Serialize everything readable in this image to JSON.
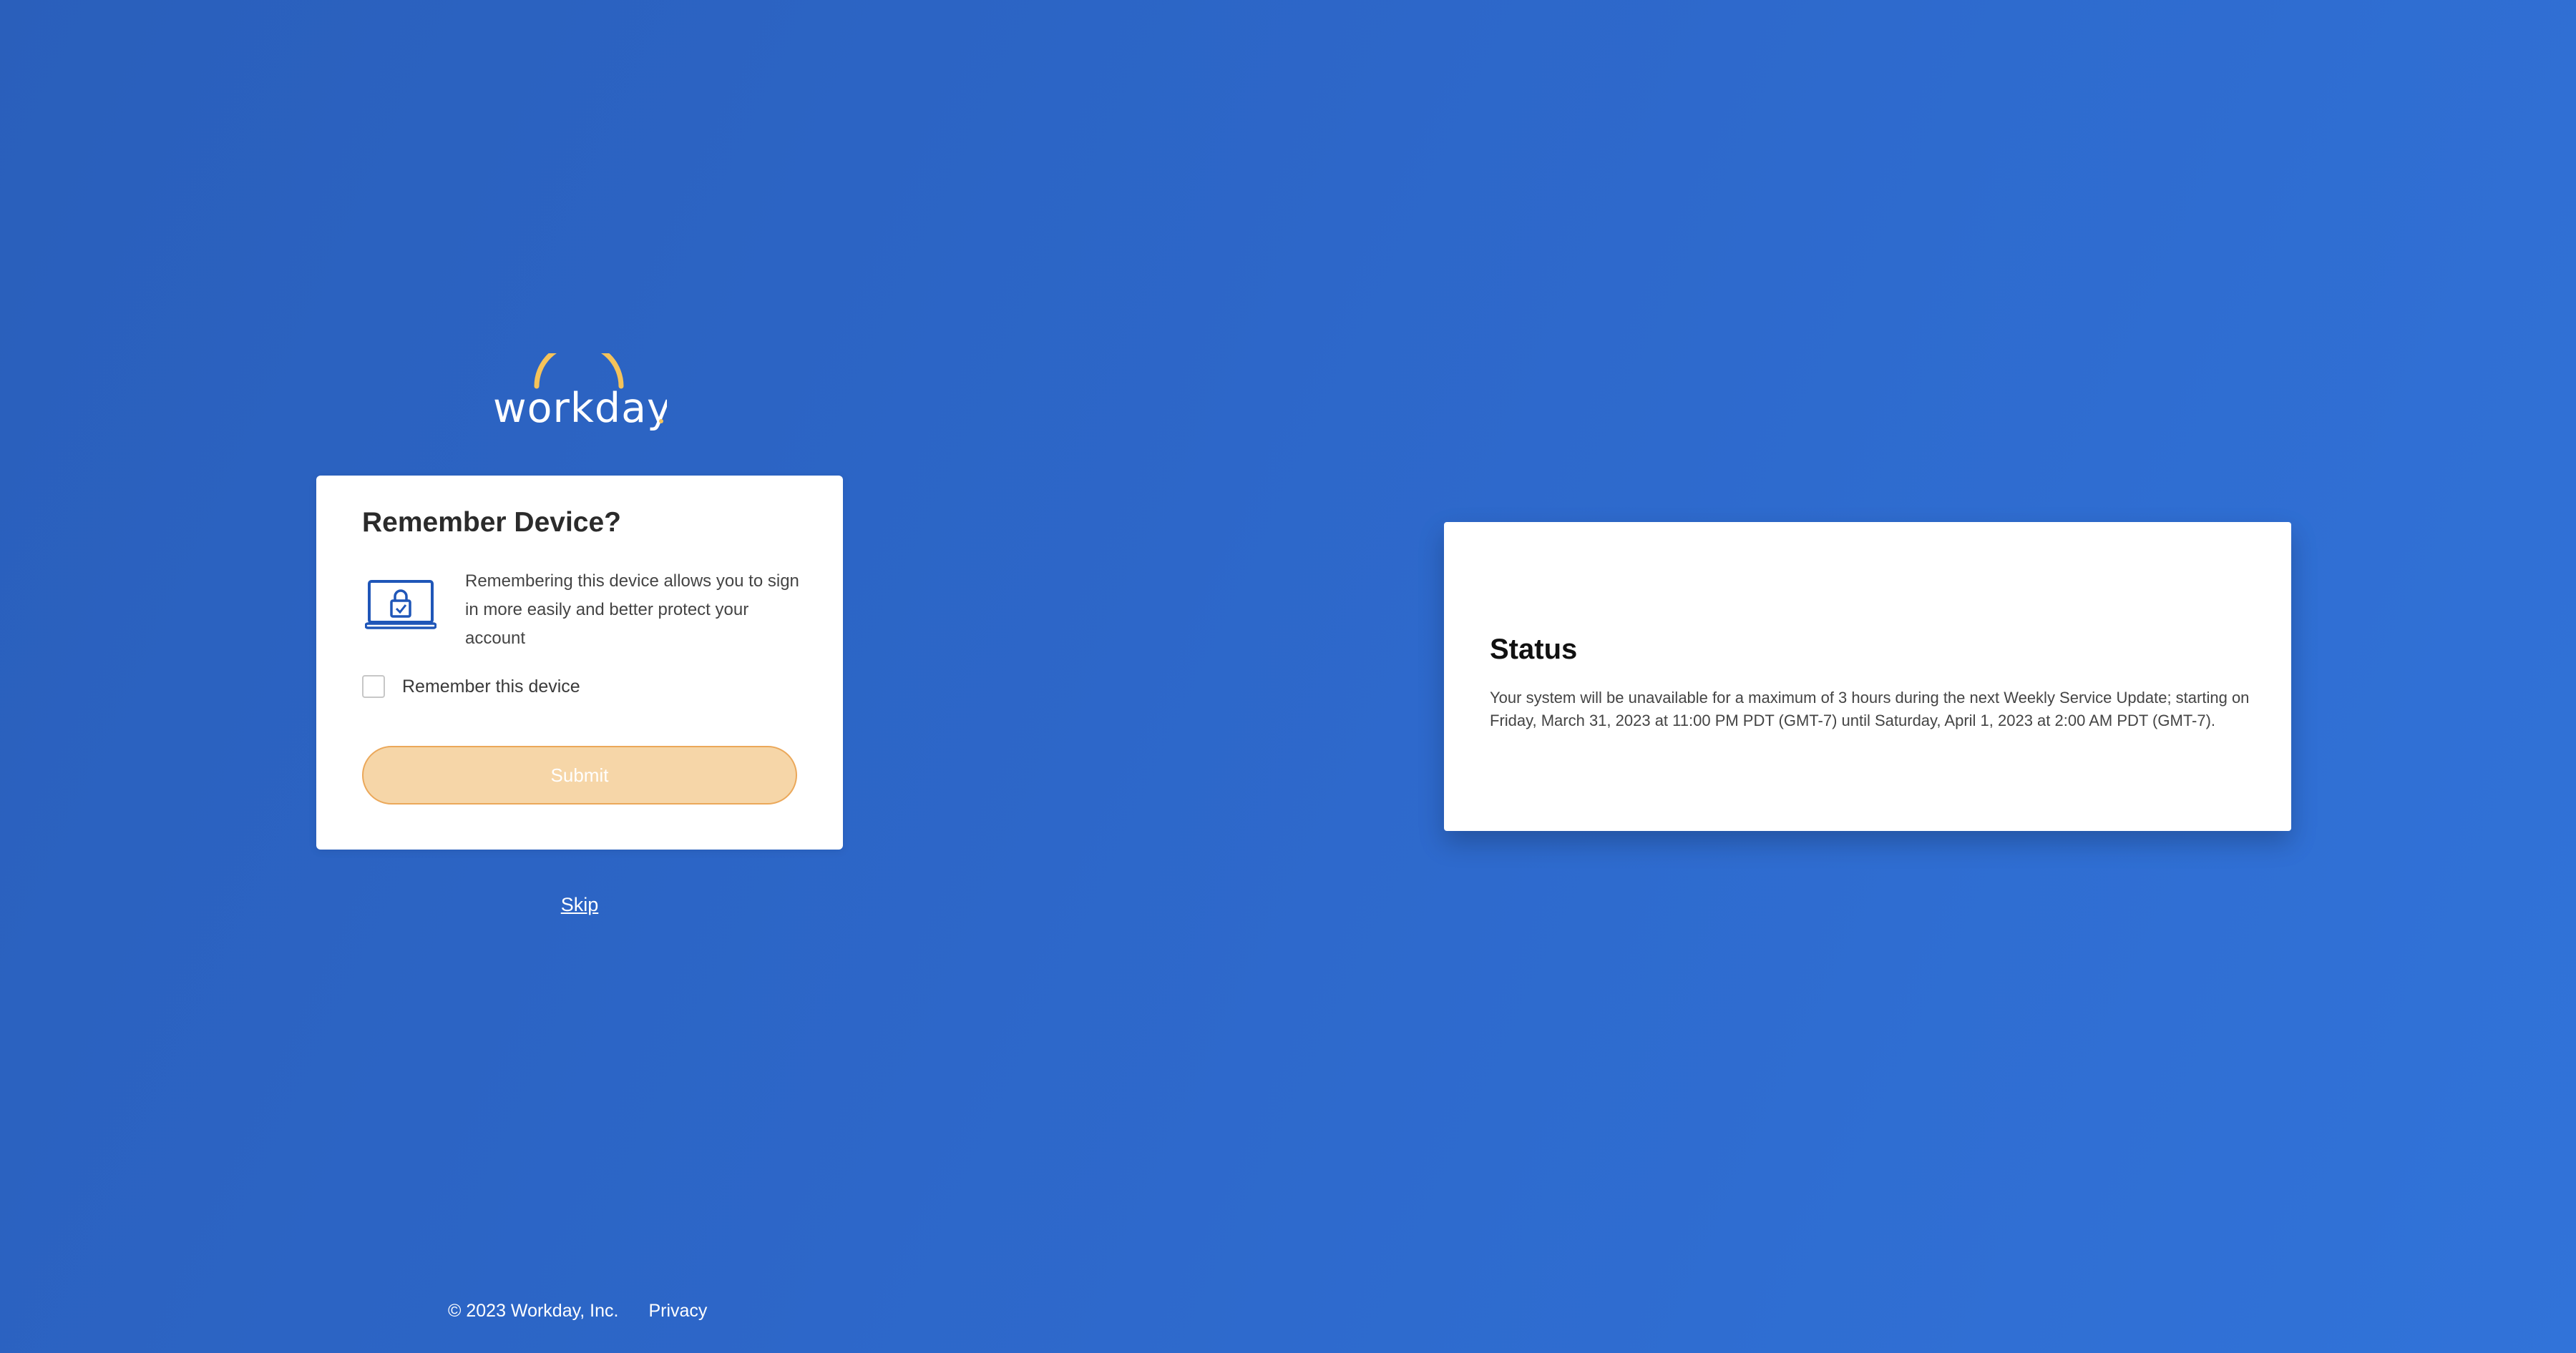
{
  "brand": {
    "logo_text": "workday",
    "logo_arc_color": "#f5c35a"
  },
  "remember_device": {
    "title": "Remember Device?",
    "icon": "laptop-lock-icon",
    "description": "Remembering this device allows you to sign in more easily and better protect your account",
    "checkbox_label": "Remember this device",
    "checkbox_checked": false,
    "submit_label": "Submit",
    "submit_enabled": false
  },
  "skip_label": "Skip",
  "status": {
    "title": "Status",
    "message": "Your system will be unavailable for a maximum of 3 hours during the next Weekly Service Update; starting on Friday, March 31, 2023 at 11:00 PM PDT (GMT-7) until Saturday, April 1, 2023 at 2:00 AM PDT (GMT-7)."
  },
  "footer": {
    "copyright": "© 2023 Workday, Inc.",
    "privacy_label": "Privacy"
  },
  "colors": {
    "background_start": "#2a5fbb",
    "background_end": "#3173d9",
    "submit_fill": "#f6d6a8",
    "submit_border": "#eba85a",
    "icon_blue": "#1f56b8"
  }
}
